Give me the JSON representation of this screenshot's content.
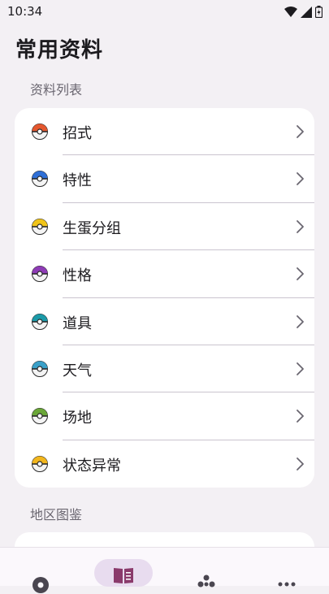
{
  "status_bar": {
    "time": "10:34"
  },
  "title": "常用资料",
  "sections": {
    "list_title": "资料列表",
    "region_title": "地区图鉴"
  },
  "items": [
    {
      "label": "招式",
      "ball_color": "#e4572e"
    },
    {
      "label": "特性",
      "ball_color": "#2f6fd6"
    },
    {
      "label": "生蛋分组",
      "ball_color": "#f0c419"
    },
    {
      "label": "性格",
      "ball_color": "#8e3bb6"
    },
    {
      "label": "道具",
      "ball_color": "#1b9aa8"
    },
    {
      "label": "天气",
      "ball_color": "#3aa0c8"
    },
    {
      "label": "场地",
      "ball_color": "#6aa638"
    },
    {
      "label": "状态异常",
      "ball_color": "#f2b61d"
    }
  ],
  "colors": {
    "accent": "#8a3a6b",
    "nav_active_bg": "#e8dcef"
  },
  "bottom_nav": [
    {
      "icon": "pokeball-icon",
      "active": false
    },
    {
      "icon": "book-icon",
      "active": true
    },
    {
      "icon": "sparkle-icon",
      "active": false
    },
    {
      "icon": "more-icon",
      "active": false
    }
  ]
}
